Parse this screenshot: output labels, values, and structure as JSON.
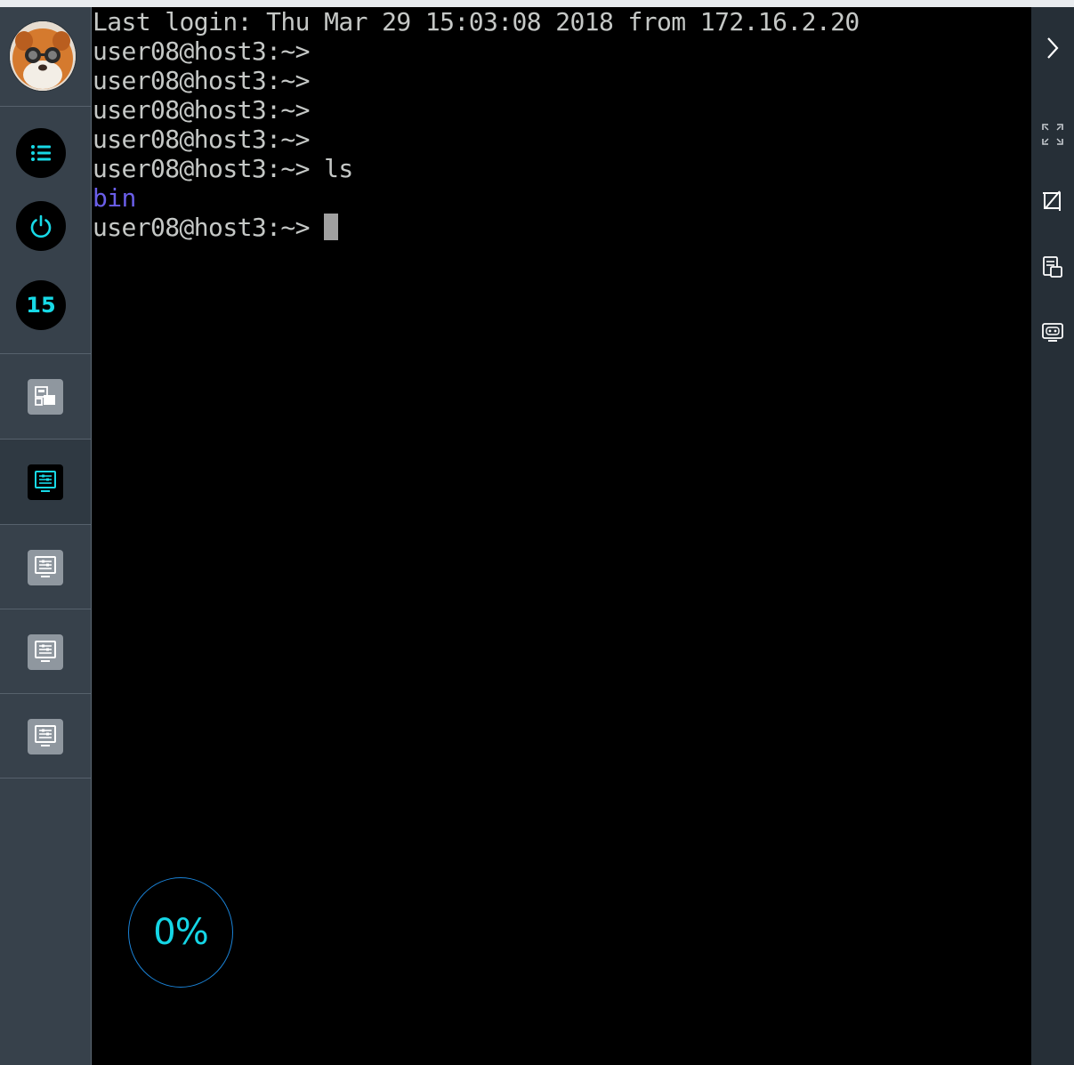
{
  "sidebar": {
    "task_count": "15",
    "buttons": [
      "menu-icon",
      "power-icon"
    ],
    "nav_items": [
      "window-switch-icon",
      "remote-desktop-icon",
      "remote-desktop-icon",
      "remote-desktop-icon",
      "remote-desktop-icon"
    ],
    "active_nav_index": 1
  },
  "terminal": {
    "lines": [
      "Last login: Thu Mar 29 15:03:08 2018 from 172.16.2.20",
      "user08@host3:~>",
      "user08@host3:~>",
      "user08@host3:~>",
      "user08@host3:~>",
      "user08@host3:~> ls",
      "bin"
    ],
    "prompt": "user08@host3:~> ",
    "directory_color": "#6a5ee8"
  },
  "progress": {
    "label": "0%",
    "value": 0
  },
  "rightbar": {
    "buttons": [
      "expand-icon",
      "fullscreen-icon",
      "crop-icon",
      "clipboard-icon",
      "keyboard-icon"
    ]
  },
  "colors": {
    "accent": "#17d9e6",
    "ring": "#1a82d6",
    "sidebar": "#37414b"
  }
}
